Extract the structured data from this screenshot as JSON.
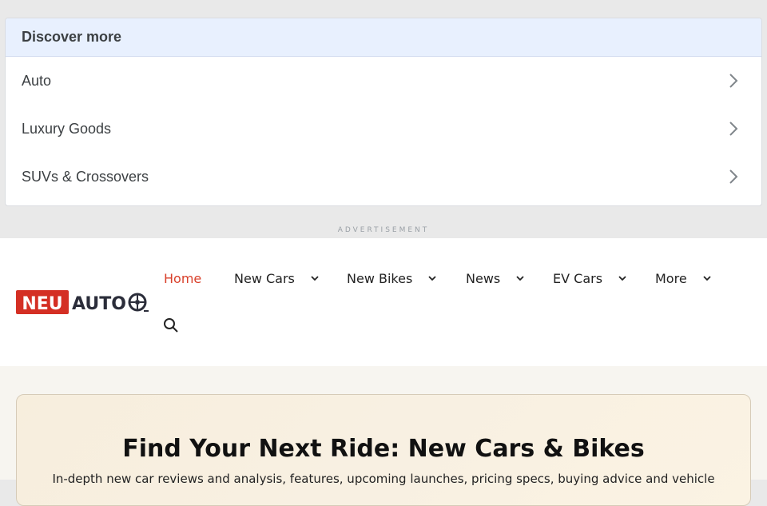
{
  "discover": {
    "title": "Discover more",
    "items": [
      {
        "label": "Auto"
      },
      {
        "label": "Luxury Goods"
      },
      {
        "label": "SUVs & Crossovers"
      }
    ]
  },
  "ad_label": "ADVERTISEMENT",
  "logo": {
    "part1": "NEU",
    "part2": "AUTO"
  },
  "nav": {
    "items": [
      {
        "label": "Home",
        "active": true
      },
      {
        "label": "New Cars",
        "has_dropdown": true
      },
      {
        "label": "New Bikes",
        "has_dropdown": true
      },
      {
        "label": "News",
        "has_dropdown": true
      },
      {
        "label": "EV Cars",
        "has_dropdown": true
      },
      {
        "label": "More",
        "has_dropdown": true
      }
    ],
    "search_icon": "search-icon"
  },
  "hero": {
    "title": "Find Your Next Ride: New Cars & Bikes",
    "subtitle": "In-depth new car reviews and analysis, features, upcoming launches, pricing specs, buying advice and vehicle"
  },
  "colors": {
    "accent": "#d9402b",
    "logo_red": "#d42f24",
    "logo_dark": "#2b2d3a",
    "discover_header_bg": "#e8f0fe"
  }
}
